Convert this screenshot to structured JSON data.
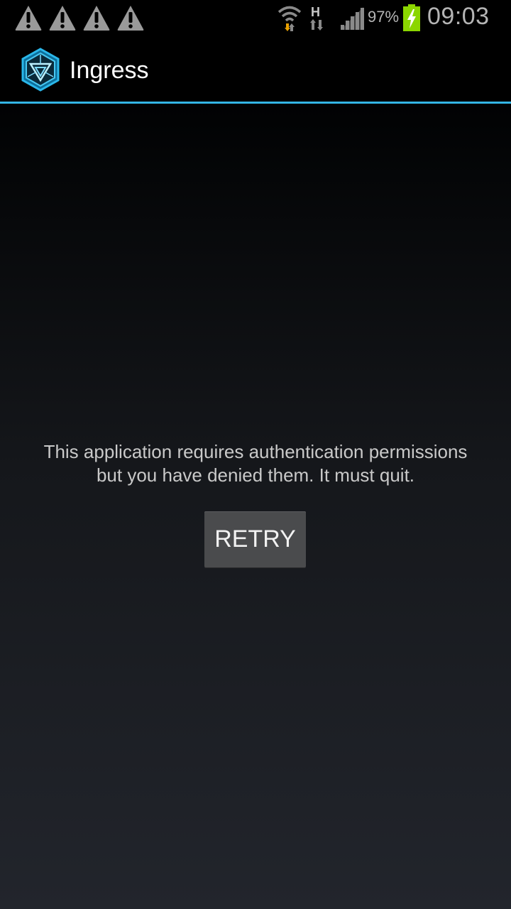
{
  "status_bar": {
    "notification_icons": [
      "warning-icon",
      "warning-icon",
      "warning-icon",
      "warning-icon"
    ],
    "network_type": "H",
    "battery_percent": "97%",
    "battery_level": 0.97,
    "clock": "09:03"
  },
  "action_bar": {
    "title": "Ingress",
    "icon": "ingress-logo-icon",
    "divider_color": "#33b5e5"
  },
  "main": {
    "message_line1": "This application requires authentication permissions",
    "message_line2": "but you have denied them. It must quit.",
    "retry_label": "RETRY"
  },
  "colors": {
    "accent": "#33b5e5",
    "battery_green": "#8bd600",
    "warning_gray": "#9a9a9a"
  }
}
